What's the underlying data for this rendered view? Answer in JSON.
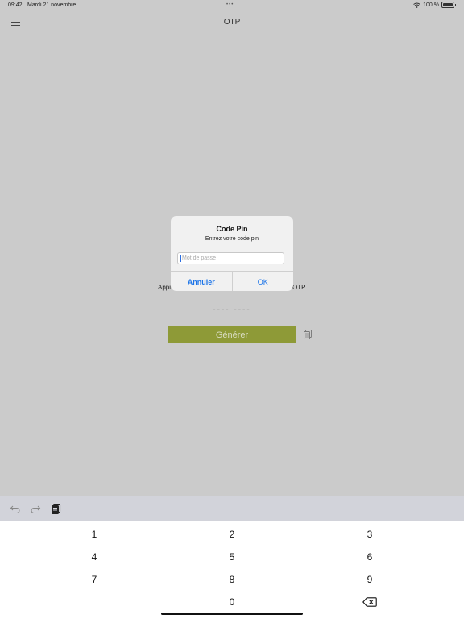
{
  "status_bar": {
    "time": "09:42",
    "date": "Mardi 21 novembre",
    "dots": "•••",
    "battery": "100 %"
  },
  "nav": {
    "title": "OTP",
    "menu_icon": "hamburger-menu-icon"
  },
  "main": {
    "instruction_left": "Appu",
    "instruction_right": "OTP.",
    "otp_placeholder": "---- ----",
    "generate_label": "Générer",
    "copy_icon": "copy-icon"
  },
  "alert": {
    "title": "Code Pin",
    "message": "Entrez votre code pin",
    "input_placeholder": "Mot de passe",
    "cancel_label": "Annuler",
    "ok_label": "OK"
  },
  "keyboard": {
    "toolbar_icons": [
      "undo-icon",
      "redo-icon",
      "paste-icon"
    ],
    "keys": [
      "1",
      "2",
      "3",
      "4",
      "5",
      "6",
      "7",
      "8",
      "9",
      "0"
    ],
    "delete_icon": "backspace-icon"
  },
  "colors": {
    "background": "#cbcbcb",
    "generate_button": "#8e9a37",
    "accent": "#1a73e8"
  }
}
